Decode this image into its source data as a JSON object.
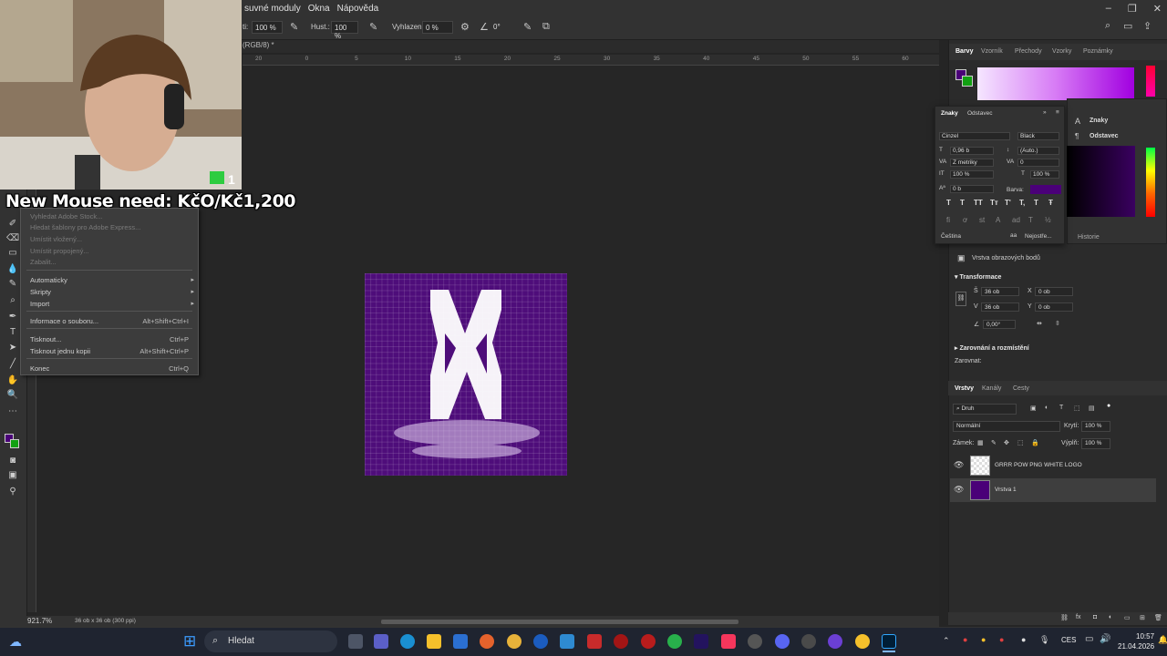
{
  "menubar": {
    "items": [
      "suvné moduly",
      "Okna",
      "Nápověda"
    ]
  },
  "options": {
    "size_value": "100 %",
    "hust_label": "Hust.:",
    "hust_value": "100 %",
    "vyhlazeni_label": "Vyhlazení:",
    "vyhlazeni_value": "0 %",
    "angle_value": "0°"
  },
  "document": {
    "tab_label": "(RGB/8) *"
  },
  "ruler": {
    "ticks": [
      "20",
      "0",
      "5",
      "10",
      "15",
      "20",
      "25",
      "30",
      "35",
      "40",
      "45",
      "50",
      "55",
      "60"
    ]
  },
  "overlay": {
    "text": "New Mouse need: KčO/Kč1,200",
    "badge": "1"
  },
  "context_menu": {
    "items": [
      {
        "label": "Vyhledat Adobe Stock...",
        "disabled": true
      },
      {
        "label": "Hledat šablony pro Adobe Express...",
        "disabled": true
      },
      {
        "label": "Umístit vložený...",
        "disabled": true
      },
      {
        "label": "Umístit propojený...",
        "disabled": true
      },
      {
        "label": "Zabalit...",
        "disabled": true
      },
      {
        "label": "Automaticky",
        "submenu": true
      },
      {
        "label": "Skripty",
        "submenu": true
      },
      {
        "label": "Import",
        "submenu": true
      },
      {
        "label": "Informace o souboru...",
        "shortcut": "Alt+Shift+Ctrl+I"
      },
      {
        "label": "Tisknout...",
        "shortcut": "Ctrl+P"
      },
      {
        "label": "Tisknout jednu kopii",
        "shortcut": "Alt+Shift+Ctrl+P"
      },
      {
        "label": "Konec",
        "shortcut": "Ctrl+Q"
      }
    ]
  },
  "status": {
    "zoom": "921.7%",
    "doc_info": "36 ob x 36 ob (300 ppi)"
  },
  "color_panel": {
    "tabs": [
      "Barvy",
      "Vzorník",
      "Přechody",
      "Vzorky",
      "Poznámky"
    ],
    "fg_color": "#4a0078",
    "bg_color": "#12a012"
  },
  "character_panel": {
    "tabs": [
      "Znaky",
      "Odstavec"
    ],
    "font_family": "Cinzel",
    "font_style": "Black",
    "size": "0,96 b",
    "leading": "(Auto.)",
    "kerning": "Z metriky",
    "tracking": "0",
    "vscale": "100 %",
    "hscale": "100 %",
    "baseline": "0 b",
    "color_label": "Barva:",
    "language": "Čeština",
    "antialias": "Nejostře..."
  },
  "side_panel": {
    "items": [
      "Znaky",
      "Odstavec"
    ]
  },
  "history_tab": "Historie",
  "properties": {
    "layer_type": "Vrstva obrazových bodů",
    "transform_title": "Transformace",
    "w_label": "Š",
    "w_value": "36 ob",
    "x_label": "X",
    "x_value": "0 ob",
    "h_label": "V",
    "h_value": "36 ob",
    "y_label": "Y",
    "y_value": "0 ob",
    "angle_value": "0,00°",
    "align_title": "Zarovnání a rozmístění",
    "align_label": "Zarovnat:"
  },
  "layers_panel": {
    "tabs": [
      "Vrstvy",
      "Kanály",
      "Cesty"
    ],
    "filter": "Druh",
    "blend_mode": "Normální",
    "opacity_label": "Krytí:",
    "opacity_value": "100 %",
    "lock_label": "Zámek:",
    "fill_label": "Výplň:",
    "fill_value": "100 %",
    "layers": [
      {
        "name": "GRRR POW PNG WHITE LOGO",
        "selected": false
      },
      {
        "name": "Vrstva 1",
        "selected": true
      }
    ]
  },
  "taskbar": {
    "search": "Hledat",
    "lang": "CES",
    "time": "10:57",
    "date": "21.04.2026"
  }
}
